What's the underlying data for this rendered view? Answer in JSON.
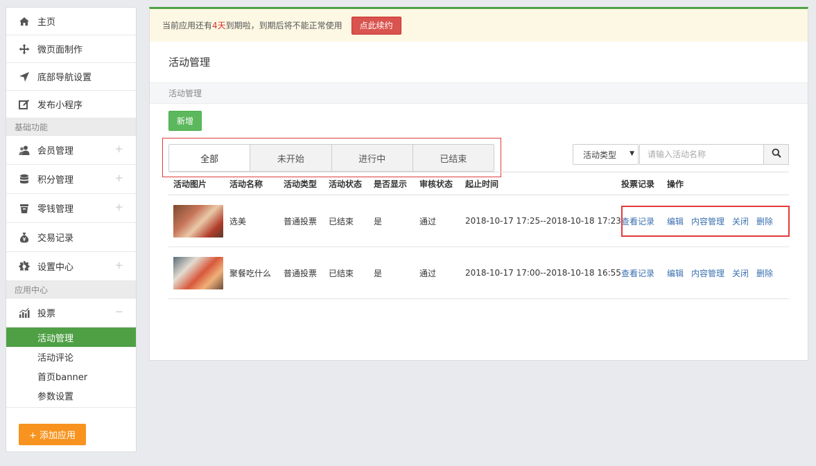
{
  "sidebar": {
    "items": [
      {
        "label": "主页",
        "icon": "home-icon"
      },
      {
        "label": "微页面制作",
        "icon": "move-icon"
      },
      {
        "label": "底部导航设置",
        "icon": "navigation-arrow-icon"
      },
      {
        "label": "发布小程序",
        "icon": "edit-icon"
      }
    ],
    "section_basic": "基础功能",
    "basic_items": [
      {
        "label": "会员管理",
        "icon": "users-icon",
        "expand": "+"
      },
      {
        "label": "积分管理",
        "icon": "database-icon",
        "expand": "+"
      },
      {
        "label": "零钱管理",
        "icon": "wallet-icon",
        "expand": "+"
      },
      {
        "label": "交易记录",
        "icon": "money-bag-icon"
      },
      {
        "label": "设置中心",
        "icon": "gear-icon",
        "expand": "+"
      }
    ],
    "section_apps": "应用中心",
    "vote": {
      "label": "投票",
      "icon": "bar-chart-icon",
      "expand": "−"
    },
    "vote_sub": [
      {
        "label": "活动管理",
        "active": true
      },
      {
        "label": "活动评论"
      },
      {
        "label": "首页banner"
      },
      {
        "label": "参数设置"
      }
    ],
    "add_app": "+ 添加应用"
  },
  "notice": {
    "prefix": "当前应用还有",
    "days": "4天",
    "suffix": "到期啦，到期后将不能正常使用",
    "renew": "点此续约"
  },
  "page_title": "活动管理",
  "breadcrumb": "活动管理",
  "new_button": "新增",
  "tabs": [
    "全部",
    "未开始",
    "进行中",
    "已结束"
  ],
  "filter": {
    "type_select": "活动类型",
    "search_placeholder": "请输入活动名称"
  },
  "table": {
    "headers": [
      "活动图片",
      "活动名称",
      "活动类型",
      "活动状态",
      "是否显示",
      "审核状态",
      "起止时间",
      "投票记录",
      "操作"
    ],
    "rows": [
      {
        "name": "选美",
        "type": "普通投票",
        "status": "已结束",
        "show": "是",
        "audit": "通过",
        "time": "2018-10-17 17:25--2018-10-18 17:23",
        "ops": [
          "查看记录",
          "编辑",
          "内容管理",
          "关闭",
          "删除"
        ]
      },
      {
        "name": "聚餐吃什么",
        "type": "普通投票",
        "status": "已结束",
        "show": "是",
        "audit": "通过",
        "time": "2018-10-17 17:00--2018-10-18 16:55",
        "ops": [
          "查看记录",
          "编辑",
          "内容管理",
          "关闭",
          "删除"
        ]
      }
    ]
  },
  "colors": {
    "accent": "#4fa045",
    "danger": "#d9534f",
    "link": "#3a6fb0",
    "warn_bg": "#fcf8e3",
    "orange": "#f7931e"
  }
}
